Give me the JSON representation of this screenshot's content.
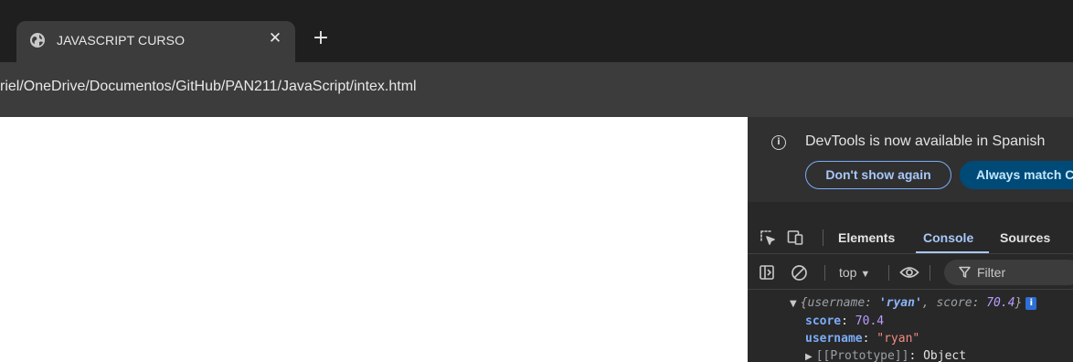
{
  "browser": {
    "tab": {
      "title": "JAVASCRIPT CURSO",
      "favicon": "globe-icon",
      "close_label": "✕"
    },
    "new_tab_label": "+",
    "address_bar": {
      "url": "riel/OneDrive/Documentos/GitHub/PAN211/JavaScript/intex.html"
    }
  },
  "devtools": {
    "infobar": {
      "icon": "info-icon",
      "message": "DevTools is now available in Spanish",
      "dont_show_label": "Don't show again",
      "always_match_label": "Always match C"
    },
    "tabs": [
      {
        "label": "Elements"
      },
      {
        "label": "Console",
        "active": true
      },
      {
        "label": "Sources"
      }
    ],
    "console_toolbar": {
      "context": "top",
      "filter_placeholder": "Filter"
    },
    "console": {
      "summary": {
        "open_brace": "{",
        "key1": "username",
        "colon": ": ",
        "val1": "'ryan'",
        "comma": ", ",
        "key2": "score",
        "val2": "70.4",
        "close_brace": "}",
        "badge": "i"
      },
      "props": [
        {
          "key": "score",
          "value": "70.4"
        },
        {
          "key": "username",
          "value": "\"ryan\""
        }
      ],
      "prototype": {
        "key": "[[Prototype]]",
        "value": "Object"
      }
    }
  },
  "colors": {
    "tabstrip_bg": "#1f1f1f",
    "toolbar_bg": "#3c3c3c",
    "devtools_bg": "#282828",
    "accent": "#a8c7fa"
  }
}
